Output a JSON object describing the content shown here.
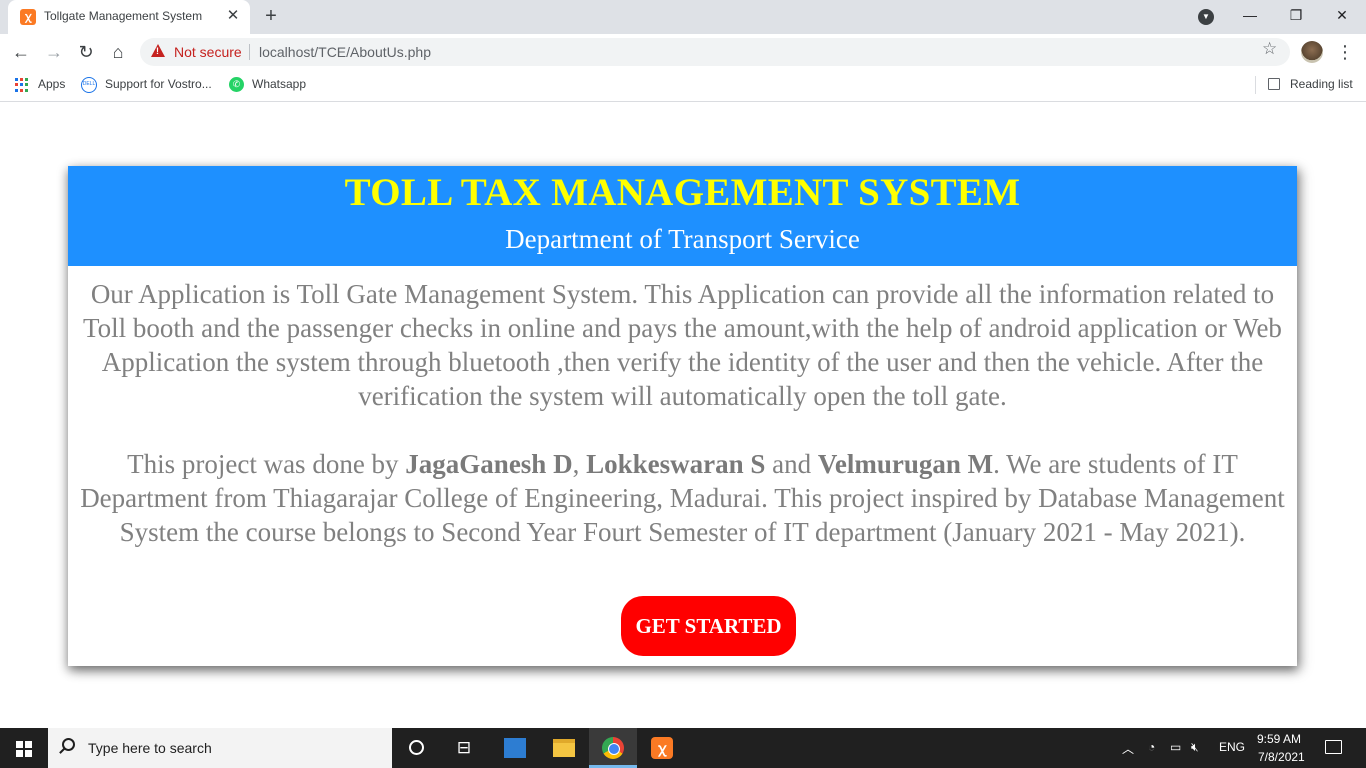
{
  "browser": {
    "tab_title": "Tollgate Management System",
    "tab_close": "✕",
    "new_tab": "+",
    "security_label": "Not secure",
    "url": "localhost/TCE/AboutUs.php",
    "bookmarks": [
      {
        "label": "Apps",
        "icon": "apps-grid-icon"
      },
      {
        "label": "Support for Vostro...",
        "icon": "dell-icon"
      },
      {
        "label": "Whatsapp",
        "icon": "whatsapp-icon"
      }
    ],
    "reading_list": "Reading list"
  },
  "page": {
    "title": "TOLL TAX MANAGEMENT SYSTEM",
    "subtitle": "Department of Transport Service",
    "paragraph1": "Our Application is Toll Gate Management System. This Application can provide all the information related to Toll booth and the passenger checks in online and pays the amount,with the help of android application or Web Application the system through bluetooth ,then verify the identity of the user and then the vehicle. After the verification the system will automatically open the toll gate.",
    "paragraph2": {
      "intro": "This project was done by ",
      "member1": "JagaGanesh D",
      "sep1": ", ",
      "member2": "Lokkeswaran S",
      "sep2": " and ",
      "member3": "Velmurugan M",
      "rest": ". We are students of IT Department from Thiagarajar College of Engineering, Madurai. This project inspired by Database Management System the course belongs to Second Year Fourt Semester of IT department (January 2021 - May 2021)."
    },
    "cta_label": "GET STARTED",
    "colors": {
      "header_bg": "#1e90ff",
      "title": "#ffff00",
      "cta_bg": "#ff0000",
      "body_text": "#808080"
    }
  },
  "taskbar": {
    "search_placeholder": "Type here to search",
    "language": "ENG",
    "time": "9:59 AM",
    "date": "7/8/2021"
  }
}
